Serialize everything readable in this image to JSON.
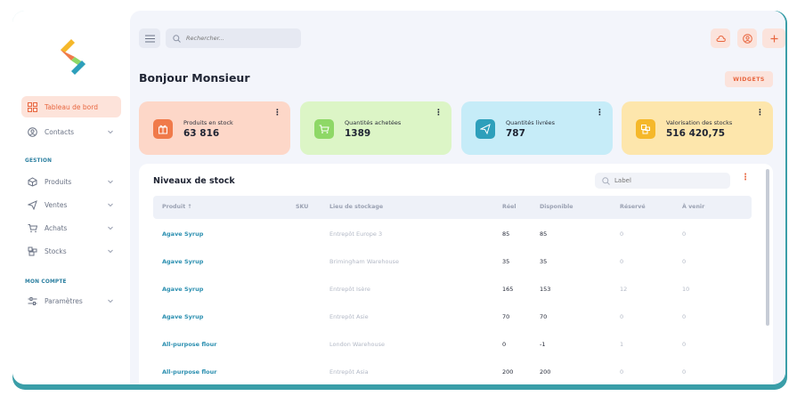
{
  "sidebar": {
    "items": [
      {
        "label": "Tableau de bord"
      },
      {
        "label": "Contacts"
      },
      {
        "label": "Produits"
      },
      {
        "label": "Ventes"
      },
      {
        "label": "Achats"
      },
      {
        "label": "Stocks"
      },
      {
        "label": "Paramètres"
      }
    ],
    "sections": {
      "gestion": "GESTION",
      "account": "MON COMPTE"
    }
  },
  "header": {
    "search_placeholder": "Rechercher...",
    "title": "Bonjour Monsieur",
    "widgets_label": "WIDGETS"
  },
  "cards": [
    {
      "label": "Produits en stock",
      "value": "63 816",
      "menu": "⋮",
      "bg": "#fdd7c8",
      "icon_bg": "#f07a4a"
    },
    {
      "label": "Quantités achetées",
      "value": "1389",
      "menu": "⋮",
      "bg": "#dcf5c6",
      "icon_bg": "#8ed866"
    },
    {
      "label": "Quantités livrées",
      "value": "787",
      "menu": "⋮",
      "bg": "#c6ecf8",
      "icon_bg": "#2d9fbb"
    },
    {
      "label": "Valorisation des stocks",
      "value": "516 420,75",
      "menu": "⋮",
      "bg": "#fde6ac",
      "icon_bg": "#f5b82a"
    }
  ],
  "stock": {
    "title": "Niveaux de stock",
    "label_placeholder": "Label",
    "menu": "⋮",
    "columns": [
      "Produit ↑",
      "SKU",
      "Lieu de stockage",
      "Réel",
      "Disponible",
      "Réservé",
      "À venir"
    ],
    "rows": [
      {
        "product": "Agave Syrup",
        "sku": "",
        "location": "Entrepôt Europe 3",
        "real": "85",
        "available": "85",
        "reserved": "0",
        "incoming": "0"
      },
      {
        "product": "Agave Syrup",
        "sku": "",
        "location": "Brimingham Warehouse",
        "real": "35",
        "available": "35",
        "reserved": "0",
        "incoming": "0"
      },
      {
        "product": "Agave Syrup",
        "sku": "",
        "location": "Entrepôt Isère",
        "real": "165",
        "available": "153",
        "reserved": "12",
        "incoming": "10"
      },
      {
        "product": "Agave Syrup",
        "sku": "",
        "location": "Entrepôt Asie",
        "real": "70",
        "available": "70",
        "reserved": "0",
        "incoming": "0"
      },
      {
        "product": "All-purpose flour",
        "sku": "",
        "location": "London Warehouse",
        "real": "0",
        "available": "-1",
        "reserved": "1",
        "incoming": "0"
      },
      {
        "product": "All-purpose flour",
        "sku": "",
        "location": "Entrepôt Asia",
        "real": "200",
        "available": "200",
        "reserved": "0",
        "incoming": "0"
      }
    ]
  },
  "colors": {
    "accent": "#e8663f",
    "teal": "#2b8fb0",
    "frame": "#3a9ea8"
  }
}
